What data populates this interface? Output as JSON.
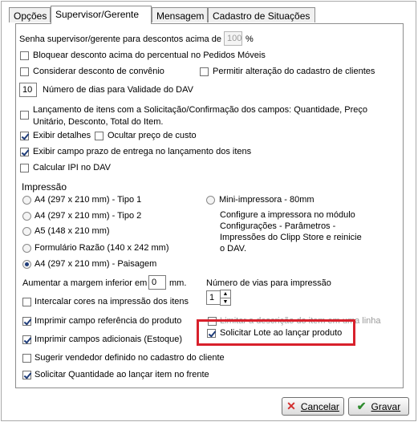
{
  "tabs": [
    "Opções",
    "Supervisor/Gerente",
    "Mensagem",
    "Cadastro de Situações"
  ],
  "discount_label": "Senha supervisor/gerente para descontos acima de",
  "discount_value": "100",
  "discount_unit": "%",
  "block_discount": "Bloquear desconto acima do percentual no Pedidos Móveis",
  "consider_agreement": "Considerar desconto de convênio",
  "allow_client_edit": "Permitir alteração do cadastro de clientes",
  "dav_days_value": "10",
  "dav_days_label": "Número de dias para Validade do DAV",
  "launch_items_line1": "Lançamento de itens com a Solicitação/Confirmação  dos campos: Quantidade, Preço",
  "launch_items_line2": "Unitário, Desconto, Total do Item.",
  "show_details": "Exibir detalhes",
  "hide_cost": "Ocultar preço de custo",
  "show_delivery": "Exibir campo prazo de entrega no lançamento dos itens",
  "calc_ipi": "Calcular IPI no DAV",
  "print_section": "Impressão",
  "print_options": [
    "A4 (297 x 210 mm) - Tipo 1",
    "A4 (297 x 210 mm) - Tipo 2",
    "A5 (148 x 210 mm)",
    "Formulário Razão (140 x 242 mm)",
    "A4 (297 x 210 mm) - Paisagem"
  ],
  "mini_printer": "Mini-impressora - 80mm",
  "mini_printer_note": [
    "Configure a impressora no módulo",
    "Configurações - Parâmetros -",
    "Impressões do Clipp Store e reinicie",
    "o DAV."
  ],
  "margin_label": "Aumentar a margem inferior em",
  "margin_value": "0",
  "margin_unit": "mm.",
  "copies_label": "Número de vias para impressão",
  "copies_value": "1",
  "interleave_colors": "Intercalar cores na impressão dos itens",
  "print_reference": "Imprimir campo referência do produto",
  "limit_description": "Limitar a descrição do item em uma linha",
  "print_additional": "Imprimir campos adicionais (Estoque)",
  "request_lot": "Solicitar Lote ao lançar produto",
  "suggest_seller": "Sugerir vendedor definido no cadastro do cliente",
  "request_quantity": "Solicitar Quantidade ao lançar item no frente",
  "cancel_label": "Cancelar",
  "save_label": "Gravar",
  "colors": {
    "highlight": "#d8212c",
    "cancel_icon": "#d32f2f",
    "save_icon": "#2e8b2e"
  }
}
